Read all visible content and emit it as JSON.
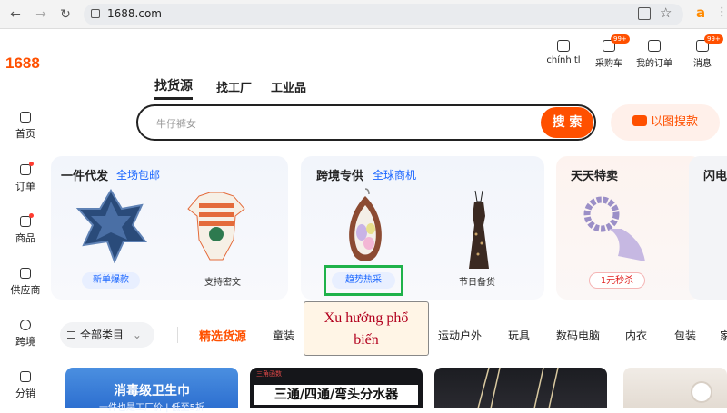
{
  "browser": {
    "url": "1688.com",
    "back_icon": "back-arrow-icon",
    "forward_icon": "forward-arrow-icon",
    "reload_icon": "reload-icon"
  },
  "sidebar": {
    "logo": "1688",
    "items": [
      {
        "label": "首页",
        "icon": "home-icon",
        "dot": false
      },
      {
        "label": "订单",
        "icon": "order-icon",
        "dot": true
      },
      {
        "label": "商品",
        "icon": "grid-icon",
        "dot": true
      },
      {
        "label": "供应商",
        "icon": "supplier-icon",
        "dot": false
      },
      {
        "label": "跨境",
        "icon": "globe-icon",
        "dot": false
      },
      {
        "label": "分销",
        "icon": "share-icon",
        "dot": false
      }
    ]
  },
  "header": {
    "items": [
      {
        "label": "chính tl",
        "badge": ""
      },
      {
        "label": "采购车",
        "badge": "99+"
      },
      {
        "label": "我的订单",
        "badge": ""
      },
      {
        "label": "消息",
        "badge": "99+"
      }
    ]
  },
  "search": {
    "tabs": [
      "找货源",
      "找工厂",
      "工业品"
    ],
    "placeholder": "牛仔裤女",
    "button": "搜 索",
    "image_search": "以图搜款"
  },
  "cards": {
    "c1": {
      "title": "一件代发",
      "sub": "全场包邮",
      "p1": "新单爆款",
      "p2": "支持密文"
    },
    "c2": {
      "title": "跨境专供",
      "sub": "全球商机",
      "p1": "趋势热采",
      "p2": "节日备货"
    },
    "c3": {
      "title": "天天特卖",
      "p1": "1元秒杀"
    },
    "c4": {
      "title": "闪电"
    }
  },
  "tooltip": {
    "line1": "Xu hướng phổ",
    "line2": "biến"
  },
  "categories": {
    "all": "全部类目",
    "active": "精选货源",
    "items": [
      "童装",
      "运动户外",
      "玩具",
      "数码电脑",
      "内衣",
      "包装",
      "家"
    ]
  },
  "banners": {
    "b1_line1": "消毒级卫生巾",
    "b1_line2": "一件也是工厂价 | 低至5折",
    "b2_top": "三角函数",
    "b2_main": "三通/四通/弯头分水器"
  },
  "colors": {
    "brand": "#ff5000",
    "link": "#1a66ff",
    "highlight": "#1fb24a"
  }
}
